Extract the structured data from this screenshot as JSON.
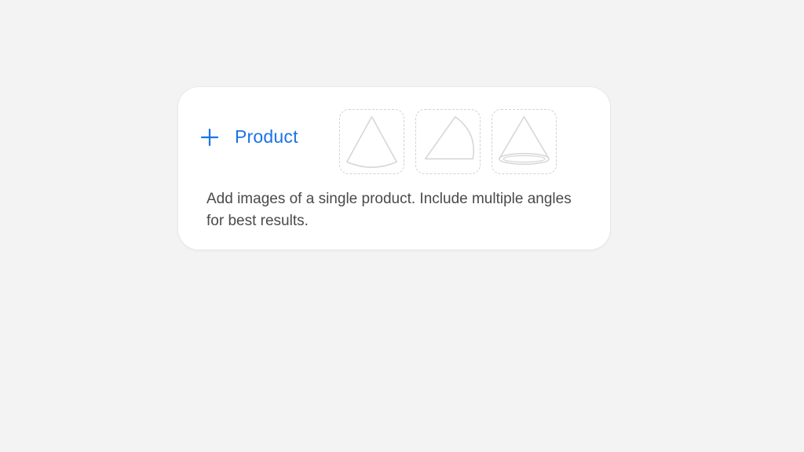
{
  "product_card": {
    "add_label": "Product",
    "description": "Add images of a single product. Include multiple angles for best results.",
    "thumbnails": [
      {
        "icon": "cone-side-icon"
      },
      {
        "icon": "cone-angled-icon"
      },
      {
        "icon": "cone-base-icon"
      }
    ]
  },
  "colors": {
    "accent": "#1a73e8",
    "background": "#f3f3f3",
    "card": "#ffffff",
    "placeholder_stroke": "#d6d6d6",
    "text": "#4a4a4a"
  }
}
